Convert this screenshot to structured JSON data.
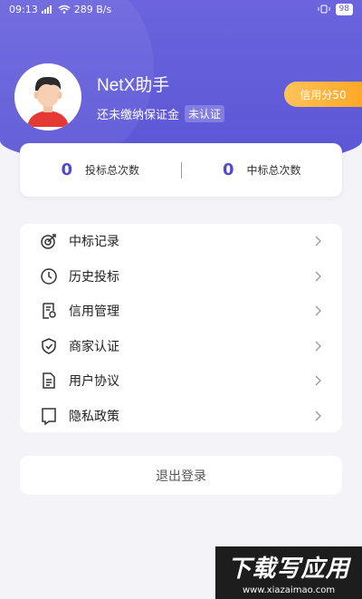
{
  "status_bar": {
    "time": "09:13",
    "network_speed": "289 B/s",
    "battery": "98"
  },
  "profile": {
    "user_name": "NetX助手",
    "deposit_text": "还未缴纳保证金",
    "certification_badge": "未认证",
    "credit_label": "信用分50"
  },
  "stats": {
    "bid_count_value": "0",
    "bid_count_label": "投标总次数",
    "win_count_value": "0",
    "win_count_label": "中标总次数"
  },
  "menu": [
    {
      "label": "中标记录",
      "icon": "target-icon"
    },
    {
      "label": "历史投标",
      "icon": "clock-icon"
    },
    {
      "label": "信用管理",
      "icon": "certificate-icon"
    },
    {
      "label": "商家认证",
      "icon": "shield-check-icon"
    },
    {
      "label": "用户协议",
      "icon": "document-icon"
    },
    {
      "label": "隐私政策",
      "icon": "bookmark-icon"
    }
  ],
  "logout_label": "退出登录",
  "watermark": {
    "title": "下载写应用",
    "url": "www.xiazaimao.com"
  },
  "colors": {
    "primary": "#5b56d6",
    "credit": "#ffa726"
  }
}
